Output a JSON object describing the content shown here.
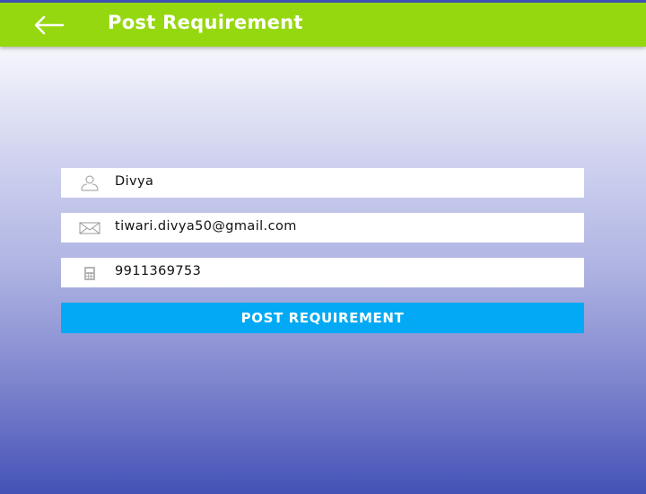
{
  "app_bar": {
    "title": "Post Requirement",
    "back_icon": "arrow-left-icon",
    "color": "#96d80f"
  },
  "form": {
    "name": {
      "value": "Divya",
      "icon": "person-icon"
    },
    "email": {
      "value": "tiwari.divya50@gmail.com",
      "icon": "envelope-icon"
    },
    "phone": {
      "value": "9911369753",
      "icon": "phone-icon"
    },
    "submit_label": "POST REQUIREMENT",
    "submit_color": "#03a9f4"
  }
}
